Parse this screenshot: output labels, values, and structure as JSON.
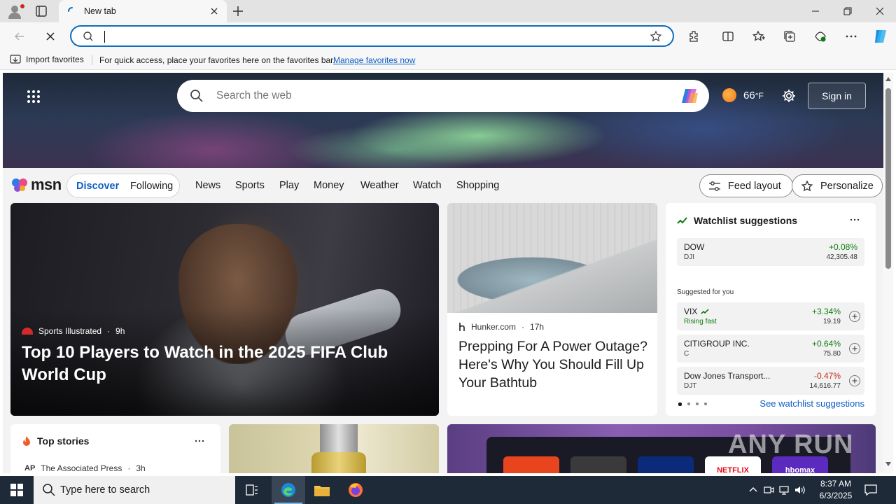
{
  "browser": {
    "tab_title": "New tab",
    "address_value": "",
    "favorites_bar": {
      "import_label": "Import favorites",
      "message": "For quick access, place your favorites here on the favorites bar.",
      "manage_link": "Manage favorites now"
    }
  },
  "msn": {
    "search_placeholder": "Search the web",
    "weather": {
      "temperature": "66",
      "unit": "°F"
    },
    "sign_in": "Sign in",
    "logo_text": "msn",
    "feed_tabs": {
      "discover": "Discover",
      "following": "Following"
    },
    "nav": [
      "News",
      "Sports",
      "Play",
      "Money",
      "Weather",
      "Watch",
      "Shopping"
    ],
    "feed_layout": "Feed layout",
    "personalize": "Personalize",
    "hero": {
      "source": "Sports Illustrated",
      "age": "9h",
      "headline": "Top 10 Players to Watch in the 2025 FIFA Club World Cup"
    },
    "card2": {
      "source": "Hunker.com",
      "age": "17h",
      "headline": "Prepping For A Power Outage? Here's Why You Should Fill Up Your Bathtub"
    },
    "watchlist": {
      "title": "Watchlist suggestions",
      "main": {
        "name": "DOW",
        "symbol": "DJI",
        "change": "+0.08%",
        "price": "42,305.48"
      },
      "suggested_label": "Suggested for you",
      "suggested": [
        {
          "name": "VIX",
          "sub": "Rising fast",
          "change": "+3.34%",
          "price": "19.19"
        },
        {
          "name": "CITIGROUP INC.",
          "sub": "C",
          "change": "+0.64%",
          "price": "75.80"
        },
        {
          "name": "Dow Jones Transport...",
          "sub": "DJT",
          "change": "-0.47%",
          "price": "14,616.77"
        }
      ],
      "see_more": "See watchlist suggestions"
    },
    "top_stories": {
      "title": "Top stories",
      "source": "The Associated Press",
      "age": "3h"
    },
    "tv_apps": [
      "NETFLIX",
      "hbomax"
    ]
  },
  "watermark": "ANY RUN",
  "taskbar": {
    "search_placeholder": "Type here to search",
    "time": "8:37 AM",
    "date": "6/3/2025"
  },
  "colors": {
    "accent": "#0f6cbd",
    "positive": "#107c10",
    "negative": "#c42b1c",
    "taskbar": "#1f2a38"
  }
}
